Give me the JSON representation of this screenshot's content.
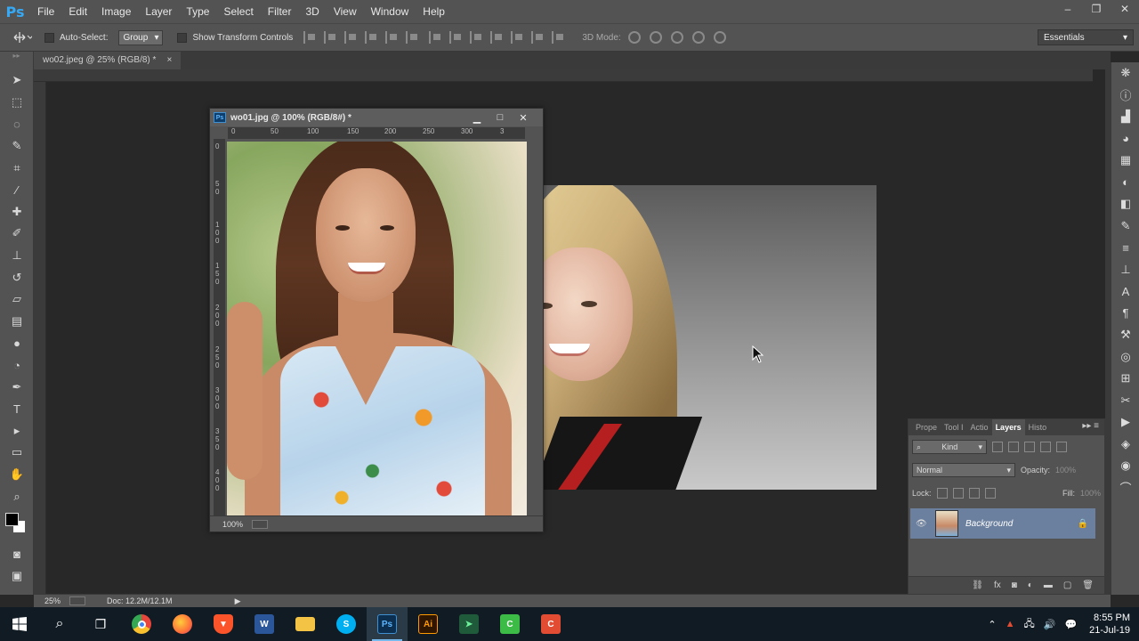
{
  "app": {
    "logo": "Ps"
  },
  "menu": [
    "File",
    "Edit",
    "Image",
    "Layer",
    "Type",
    "Select",
    "Filter",
    "3D",
    "View",
    "Window",
    "Help"
  ],
  "window_controls": [
    "–",
    "❐",
    "✕"
  ],
  "options_bar": {
    "auto_select_label": "Auto-Select:",
    "auto_select_value": "Group",
    "show_transform_label": "Show Transform Controls",
    "three_d_mode_label": "3D Mode:",
    "workspace": "Essentials"
  },
  "document_tab": {
    "title": "wo02.jpeg @ 25% (RGB/8) *",
    "close": "×"
  },
  "doc_window": {
    "ps_mini": "Ps",
    "title": "wo01.jpg @ 100% (RGB/8#) *",
    "ruler_h": [
      "0",
      "50",
      "100",
      "150",
      "200",
      "250",
      "300",
      "3"
    ],
    "ruler_v": [
      "0",
      "5\n0",
      "1\n0\n0",
      "1\n5\n0",
      "2\n0\n0",
      "2\n5\n0",
      "3\n0\n0",
      "3\n5\n0",
      "4\n0\n0"
    ],
    "zoom": "100%"
  },
  "layers_panel": {
    "tabs": [
      "Prope",
      "Tool I",
      "Actio",
      "Layers",
      "Histo"
    ],
    "active_tab": "Layers",
    "filter_kind": "Kind",
    "blend_mode": "Normal",
    "opacity_label": "Opacity:",
    "opacity_value": "100%",
    "lock_label": "Lock:",
    "fill_label": "Fill:",
    "fill_value": "100%",
    "layer_name": "Background",
    "bottom_icons": [
      "⛓",
      "fx",
      "◙",
      "◐",
      "▬",
      "▢",
      "🗑"
    ]
  },
  "status_bar": {
    "zoom": "25%",
    "doc": "Doc: 12.2M/12.1M"
  },
  "taskbar": {
    "apps": [
      {
        "name": "chrome",
        "label": "",
        "color": "#e8453c"
      },
      {
        "name": "firefox",
        "label": "",
        "color": "#ff7139"
      },
      {
        "name": "brave",
        "label": "",
        "color": "#fb542b"
      },
      {
        "name": "word",
        "label": "W",
        "color": "#2b579a"
      },
      {
        "name": "explorer",
        "label": "",
        "color": "#f3c345"
      },
      {
        "name": "skype",
        "label": "S",
        "color": "#00aff0"
      },
      {
        "name": "photoshop",
        "label": "Ps",
        "color": "#0c2f4f"
      },
      {
        "name": "illustrator",
        "label": "Ai",
        "color": "#2f1600"
      },
      {
        "name": "app-green",
        "label": "",
        "color": "#3a9a5a"
      },
      {
        "name": "camtasia",
        "label": "C",
        "color": "#3cbc46"
      },
      {
        "name": "camtasia-red",
        "label": "C",
        "color": "#e24c33"
      }
    ],
    "time": "8:55 PM",
    "date": "21-Jul-19"
  }
}
